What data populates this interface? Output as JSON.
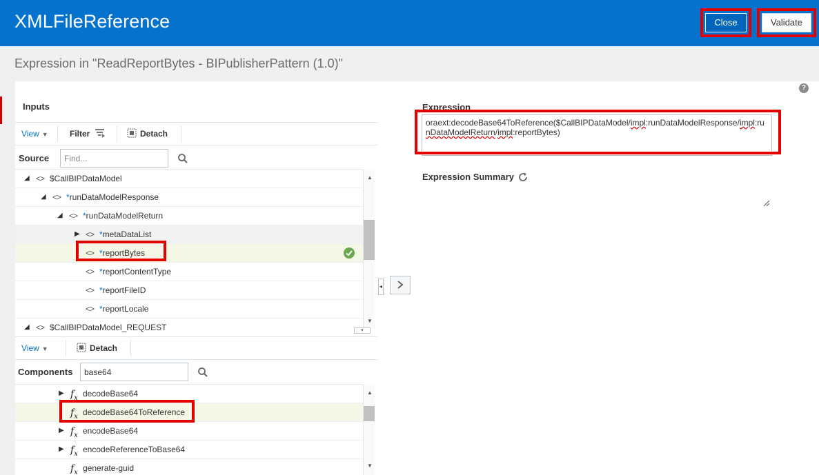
{
  "header": {
    "title": "XMLFileReference",
    "close_label": "Close",
    "validate_label": "Validate"
  },
  "subtitle": "Expression in \"ReadReportBytes - BIPublisherPattern (1.0)\"",
  "inputs": {
    "heading": "Inputs",
    "toolbar": {
      "view_label": "View",
      "filter_label": "Filter",
      "detach_label": "Detach"
    },
    "search": {
      "label": "Source",
      "placeholder": "Find...",
      "value": ""
    },
    "tree": [
      {
        "tri": "◢",
        "label": "$CallBIPDataModel"
      },
      {
        "tri": "◢",
        "label": "runDataModelResponse",
        "star": "*"
      },
      {
        "tri": "◢",
        "label": "runDataModelReturn",
        "star": "*"
      },
      {
        "tri": "▶",
        "label": "metaDataList",
        "star": "*"
      },
      {
        "label": "reportBytes",
        "star": "*",
        "valid": true
      },
      {
        "label": "reportContentType",
        "star": "*"
      },
      {
        "label": "reportFileID",
        "star": "*"
      },
      {
        "label": "reportLocale",
        "star": "*"
      },
      {
        "tri": "◢",
        "label": "$CallBIPDataModel_REQUEST"
      }
    ]
  },
  "components": {
    "toolbar": {
      "view_label": "View",
      "detach_label": "Detach"
    },
    "search": {
      "label": "Components",
      "value": "base64"
    },
    "list": [
      {
        "tri": "▶",
        "label": "decodeBase64"
      },
      {
        "label": "decodeBase64ToReference",
        "selected": true
      },
      {
        "tri": "▶",
        "label": "encodeBase64"
      },
      {
        "tri": "▶",
        "label": "encodeReferenceToBase64"
      },
      {
        "label": "generate-guid"
      }
    ]
  },
  "expression": {
    "label": "Expression",
    "prefix": "oraext:decodeBase64ToReference($CallBIPDataModel/",
    "p1": "impl",
    "p2": ":runDataModelResponse/",
    "p3": "impl",
    "p4": ":ru",
    "p5": "nDataModelReturn",
    "p6": "/",
    "p7": "impl",
    "p8": ":reportBytes)"
  },
  "summary": {
    "label": "Expression Summary"
  },
  "help": {
    "label": "?"
  },
  "colors": {
    "brand": "#0572ce",
    "highlight": "#e30000",
    "valid": "#6aa84f"
  }
}
